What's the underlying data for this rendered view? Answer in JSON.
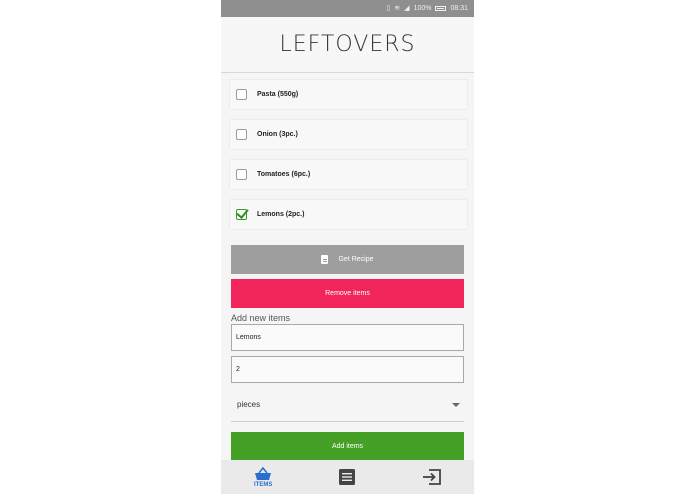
{
  "statusbar": {
    "battery": "100%",
    "time": "08:31"
  },
  "header": {
    "title": "LEFTOVERS"
  },
  "items": [
    {
      "label": "Pasta (550g)",
      "checked": false
    },
    {
      "label": "Onion (3pc.)",
      "checked": false
    },
    {
      "label": "Tomatoes (6pc.)",
      "checked": false
    },
    {
      "label": "Lemons (2pc.)",
      "checked": true
    }
  ],
  "actions": {
    "get_recipe": "Get Recipe",
    "remove_items": "Remove items"
  },
  "add_form": {
    "section_label": "Add new items",
    "name_value": "Lemons",
    "quantity_value": "2",
    "unit_value": "pieces",
    "submit_label": "Add items"
  },
  "nav": {
    "items_label": "ITEMS"
  },
  "colors": {
    "accent_blue": "#2a6fd0",
    "remove_red": "#f2255a",
    "add_green": "#45a125",
    "recipe_grey": "#9e9e9e"
  }
}
